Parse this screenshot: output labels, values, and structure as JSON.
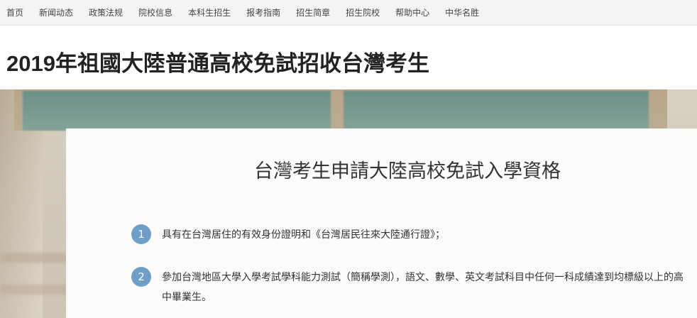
{
  "nav": {
    "items": [
      {
        "label": "首页"
      },
      {
        "label": "新闻动态"
      },
      {
        "label": "政策法规"
      },
      {
        "label": "院校信息"
      },
      {
        "label": "本科生招生"
      },
      {
        "label": "报考指南"
      },
      {
        "label": "招生简章"
      },
      {
        "label": "招生院校"
      },
      {
        "label": "帮助中心"
      },
      {
        "label": "中华名胜"
      }
    ]
  },
  "header": {
    "title": "2019年祖國大陸普通高校免試招收台灣考生"
  },
  "card": {
    "title": "台灣考生申請大陸高校免試入學資格",
    "requirements": [
      {
        "number": "1",
        "text": "具有在台灣居住的有效身份證明和《台灣居民往來大陸通行證》；"
      },
      {
        "number": "2",
        "text": "參加台灣地區大學入學考試學科能力測試（簡稱學測），語文、數學、英文考試科目中任何一科成績達到均標級以上的高中畢業生。"
      }
    ]
  },
  "colors": {
    "badge": "#6f9fc9",
    "nav_bg": "#f4f4f4",
    "chalkboard": "#6b8f86"
  }
}
